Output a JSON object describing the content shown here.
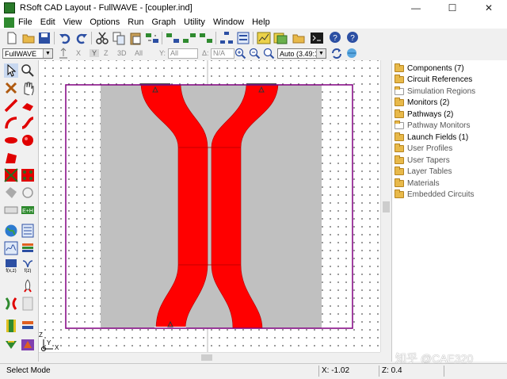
{
  "window": {
    "title": "RSoft CAD Layout - FullWAVE - [coupler.ind]",
    "minimize_label": "—",
    "maximize_label": "☐",
    "close_label": "✕"
  },
  "menu": {
    "items": [
      "File",
      "Edit",
      "View",
      "Options",
      "Run",
      "Graph",
      "Utility",
      "Window",
      "Help"
    ]
  },
  "toolbar2": {
    "program_select": "FullWAVE",
    "x_label": "X",
    "y_label": "Y",
    "z_label": "Z",
    "three_d_label": "3D",
    "all_label": "All",
    "yfield_label": "Y:",
    "yfield_value": "All",
    "dfield_label": "Δ:",
    "dfield_value": "N/A",
    "zoom_select": "Auto (3.49:1)"
  },
  "canvas": {
    "axes_label_z": "Z",
    "axes_label_x": "X",
    "axes_label_y": "Y",
    "colors": {
      "waveguide": "#ff0000",
      "domain": "#c0c0c0",
      "boundary": "#800080"
    }
  },
  "tree": {
    "items": [
      "Components (7)",
      "Circuit References",
      "Simulation Regions",
      "Monitors (2)",
      "Pathways (2)",
      "Pathway Monitors",
      "Launch Fields (1)",
      "User Profiles",
      "User Tapers",
      "Layer Tables",
      "Materials",
      "Embedded Circuits"
    ],
    "item_colors": [
      "#000000",
      "#000000",
      "#555555",
      "#000000",
      "#000000",
      "#555555",
      "#000000",
      "#555555",
      "#555555",
      "#555555",
      "#555555",
      "#555555"
    ]
  },
  "status": {
    "mode": "Select Mode",
    "x_readout": "X: -1.02",
    "z_readout": "Z: 0.4"
  },
  "watermark": "知乎 @CAE320"
}
